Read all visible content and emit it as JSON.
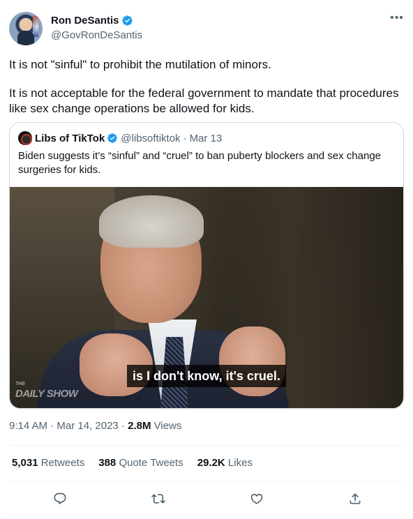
{
  "author": {
    "name": "Ron DeSantis",
    "handle": "@GovRonDeSantis"
  },
  "tweet_text": {
    "paragraph1": "It is not \"sinful\" to prohibit the mutilation of minors.",
    "paragraph2": "It is not acceptable for the federal government to mandate that procedures like sex change operations be allowed for kids."
  },
  "quoted": {
    "name": "Libs of TikTok",
    "handle": "@libsoftiktok",
    "separator": "·",
    "date": "Mar 13",
    "text": "Biden suggests it’s “sinful” and “cruel” to ban puberty blockers and sex change surgeries for kids.",
    "caption": "is I don't know, it's cruel.",
    "watermark_small": "THE",
    "watermark": "DAILY SHOW"
  },
  "meta": {
    "time": "9:14 AM",
    "separator1": " · ",
    "date": "Mar 14, 2023",
    "separator2": " · ",
    "views_count": "2.8M",
    "views_label": " Views"
  },
  "stats": {
    "retweets_count": "5,031",
    "retweets_label": " Retweets",
    "quotes_count": "388",
    "quotes_label": " Quote Tweets",
    "likes_count": "29.2K",
    "likes_label": " Likes"
  },
  "icons": {
    "more": "more-icon",
    "verified": "verified-badge-icon",
    "reply": "reply-icon",
    "retweet": "retweet-icon",
    "like": "like-icon",
    "share": "share-icon"
  },
  "colors": {
    "verified": "#1d9bf0",
    "secondary_text": "#536471",
    "primary_text": "#0f1419",
    "border": "#cfd9de"
  }
}
